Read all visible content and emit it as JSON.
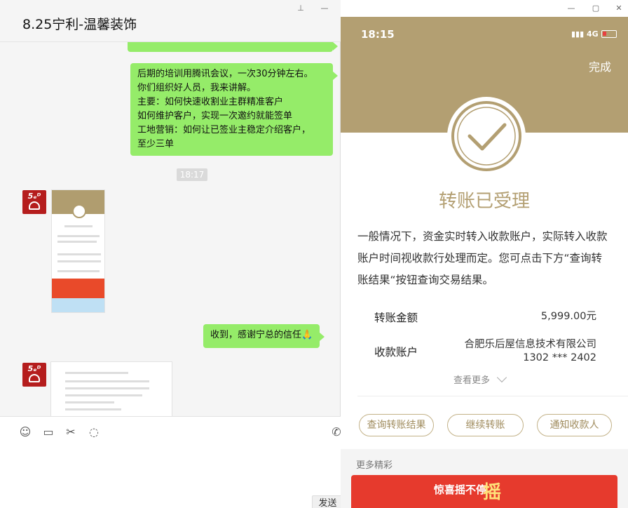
{
  "wechat": {
    "title": "8.25宁利-温馨装饰",
    "win_pin": "⊥",
    "win_min": "—",
    "messages": [
      {
        "lines": [
          "后期的培训用腾讯会议，一次30分钟左右。",
          "你们组织好人员，我来讲解。",
          "主要：如何快速收割业主群精准客户",
          "如何维护客户，实现一次邀约就能签单",
          "工地营销：如何让已签业主稳定介绍客户，",
          "至少三单"
        ]
      },
      {
        "text": "收到，感谢宁总的信任🙏"
      }
    ],
    "time_label": "18:17",
    "avatar_text": "5ₑᴰ",
    "toolbar": {
      "emoji_icon": "☺",
      "folder_icon": "▭",
      "scissors_icon": "✂",
      "chat_icon": "◌",
      "phone_icon": "✆"
    },
    "send_label": "发送"
  },
  "phone": {
    "status_time": "18:15",
    "signal": "▮▮▮ 4G",
    "done_label": "完成",
    "status_title": "转账已受理",
    "description": "一般情况下，资金实时转入收款账户，实际转入收款账户时间视收款行处理而定。您可点击下方“查询转账结果“按钮查询交易结果。",
    "amount_label": "转账金额",
    "amount_value": "5,999.00元",
    "payee_label": "收款账户",
    "payee_name": "合肥乐后屋信息技术有限公司",
    "payee_account": "1302 *** 2402",
    "more_link": "查看更多",
    "buttons": {
      "query": "查询转账结果",
      "continue": "继续转账",
      "notify": "通知收款人"
    },
    "more_section": "更多精彩",
    "promo_text": "惊喜摇不停",
    "promo_big": "摇",
    "accent_color": "#b39f72"
  }
}
